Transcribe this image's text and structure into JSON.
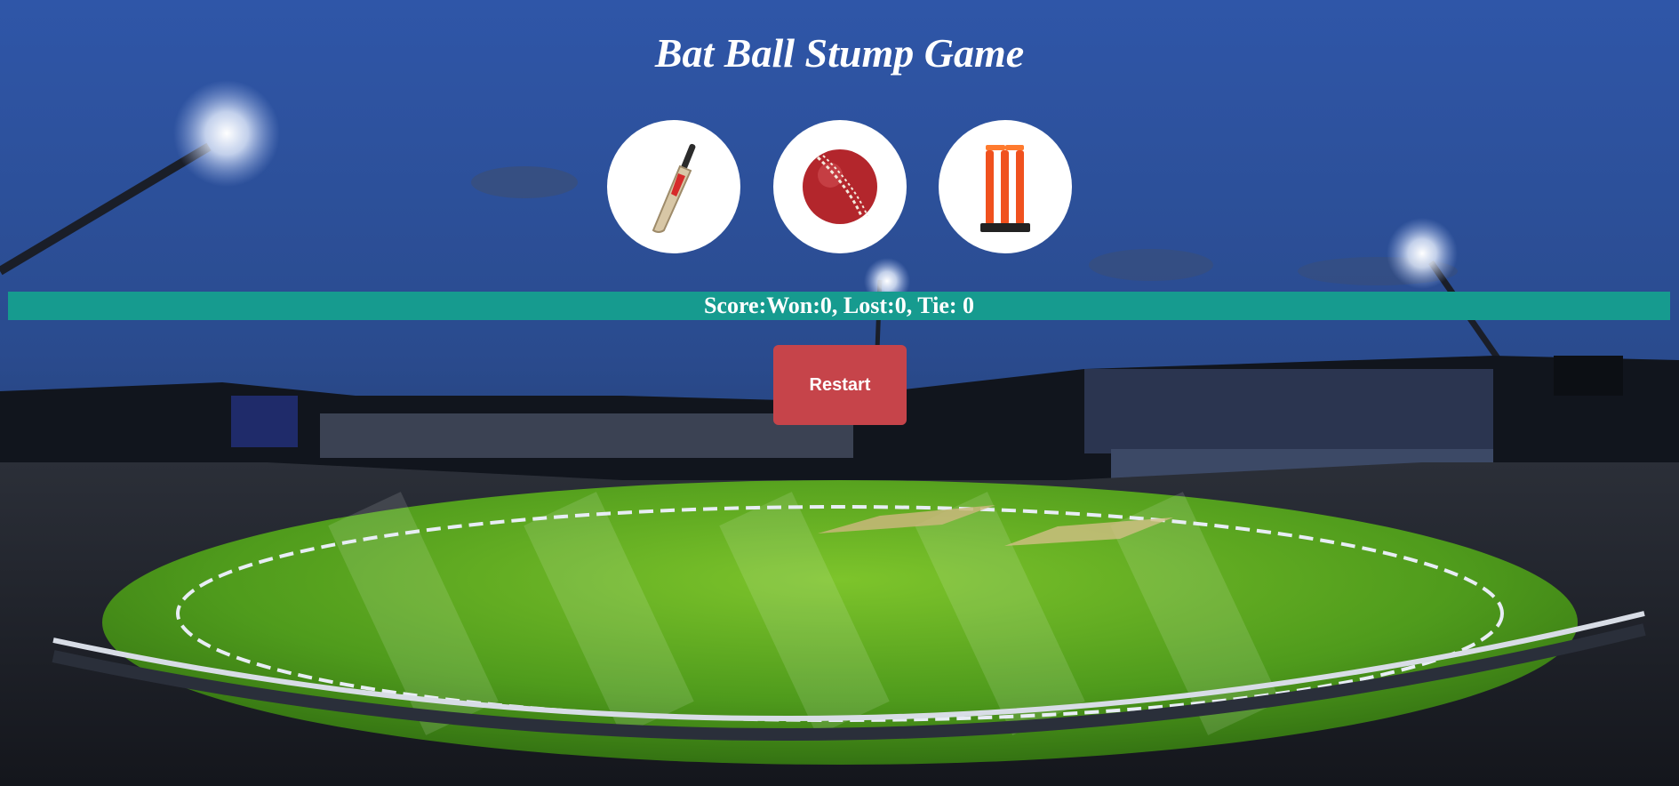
{
  "game": {
    "title": "Bat Ball Stump Game"
  },
  "choices": [
    {
      "name": "Bat",
      "icon": "cricket-bat-icon"
    },
    {
      "name": "Ball",
      "icon": "cricket-ball-icon"
    },
    {
      "name": "Stump",
      "icon": "cricket-stumps-icon"
    }
  ],
  "score": {
    "text": "Score:Won:0, Lost:0, Tie: 0",
    "won": 0,
    "lost": 0,
    "tie": 0
  },
  "controls": {
    "restart_label": "Restart"
  },
  "colors": {
    "score_bar": "#169b8f",
    "restart_button": "#c6444a",
    "ball": "#b3262c",
    "stumps": "#f0511e"
  }
}
